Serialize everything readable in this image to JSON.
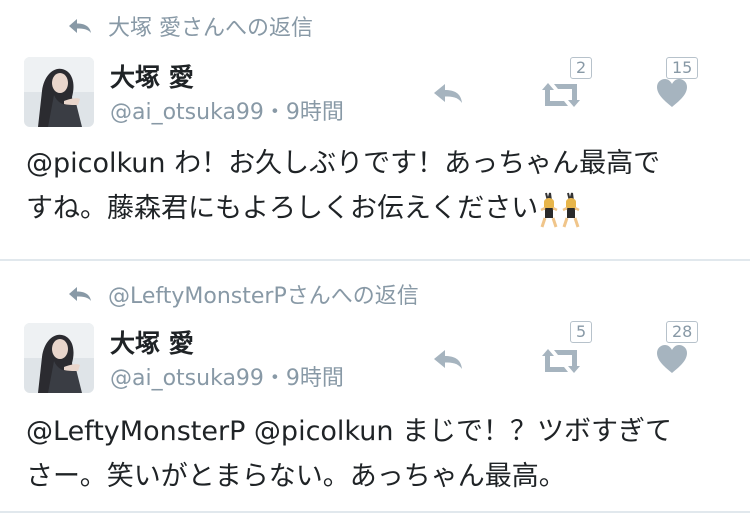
{
  "colors": {
    "secondary": "#8899a6",
    "text": "#1f2326",
    "divider": "#e1e8ed"
  },
  "tweets": [
    {
      "reply_to": "大塚 愛さんへの返信",
      "name": "大塚 愛",
      "handle_time": "@ai_otsuka99・9時間",
      "text_line1": "@picolkun わ！お久しぶりです！あっちゃん最高で",
      "text_line2": "すね。藤森君にもよろしくお伝えください",
      "emoji": "dancers-emoji",
      "retweet_count": "2",
      "favorite_count": "15"
    },
    {
      "reply_to": "@LeftyMonsterPさんへの返信",
      "name": "大塚 愛",
      "handle_time": "@ai_otsuka99・9時間",
      "text_line1": "@LeftyMonsterP @picolkun まじで！？ツボすぎて",
      "text_line2": "さー。笑いがとまらない。あっちゃん最高。",
      "retweet_count": "5",
      "favorite_count": "28"
    }
  ]
}
